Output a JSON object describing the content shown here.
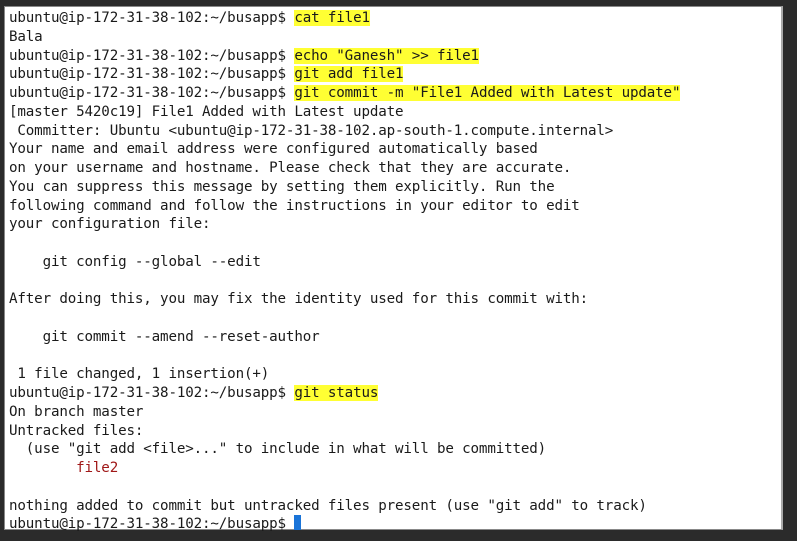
{
  "terminal": {
    "prompt": "ubuntu@ip-172-31-38-102:~/busapp$ ",
    "colors": {
      "highlight": "#ffff33",
      "untracked_file": "#a01818",
      "cursor": "#1a74d8"
    },
    "lines": [
      {
        "prompt": true,
        "cmd": "cat file1"
      },
      {
        "text": "Bala"
      },
      {
        "prompt": true,
        "cmd": "echo \"Ganesh\" >> file1"
      },
      {
        "prompt": true,
        "cmd": "git add file1"
      },
      {
        "prompt": true,
        "cmd": "git commit -m \"File1 Added with Latest update\""
      },
      {
        "text": "[master 5420c19] File1 Added with Latest update"
      },
      {
        "text": " Committer: Ubuntu <ubuntu@ip-172-31-38-102.ap-south-1.compute.internal>"
      },
      {
        "text": "Your name and email address were configured automatically based"
      },
      {
        "text": "on your username and hostname. Please check that they are accurate."
      },
      {
        "text": "You can suppress this message by setting them explicitly. Run the"
      },
      {
        "text": "following command and follow the instructions in your editor to edit"
      },
      {
        "text": "your configuration file:"
      },
      {
        "text": ""
      },
      {
        "text": "    git config --global --edit"
      },
      {
        "text": ""
      },
      {
        "text": "After doing this, you may fix the identity used for this commit with:"
      },
      {
        "text": ""
      },
      {
        "text": "    git commit --amend --reset-author"
      },
      {
        "text": ""
      },
      {
        "text": " 1 file changed, 1 insertion(+)"
      },
      {
        "prompt": true,
        "cmd": "git status"
      },
      {
        "text": "On branch master"
      },
      {
        "text": "Untracked files:"
      },
      {
        "text": "  (use \"git add <file>...\" to include in what will be committed)"
      },
      {
        "text": "        file2",
        "red": true
      },
      {
        "text": ""
      },
      {
        "text": "nothing added to commit but untracked files present (use \"git add\" to track)"
      },
      {
        "prompt": true,
        "cmd": "",
        "cursor": true
      }
    ]
  }
}
